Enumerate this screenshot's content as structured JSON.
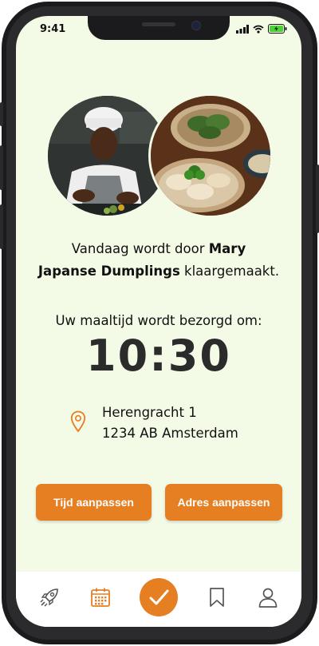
{
  "status_bar": {
    "time": "9:41"
  },
  "message": {
    "prefix": "Vandaag wordt door ",
    "chef_name": "Mary",
    "dish_name": "Japanse Dumplings",
    "suffix": " klaargemaakt."
  },
  "delivery": {
    "label": "Uw maaltijd wordt bezorgd om:",
    "time": "10:30"
  },
  "address": {
    "line1": "Herengracht 1",
    "line2": "1234 AB Amsterdam"
  },
  "buttons": {
    "change_time": "Tijd aanpassen",
    "change_address": "Adres aanpassen"
  },
  "nav": {
    "items": [
      {
        "icon": "rocket-icon"
      },
      {
        "icon": "calendar-icon"
      },
      {
        "icon": "check-icon"
      },
      {
        "icon": "bookmark-icon"
      },
      {
        "icon": "user-icon"
      }
    ]
  },
  "colors": {
    "accent": "#e67e22",
    "background": "#f3fae6",
    "text": "#111111"
  }
}
